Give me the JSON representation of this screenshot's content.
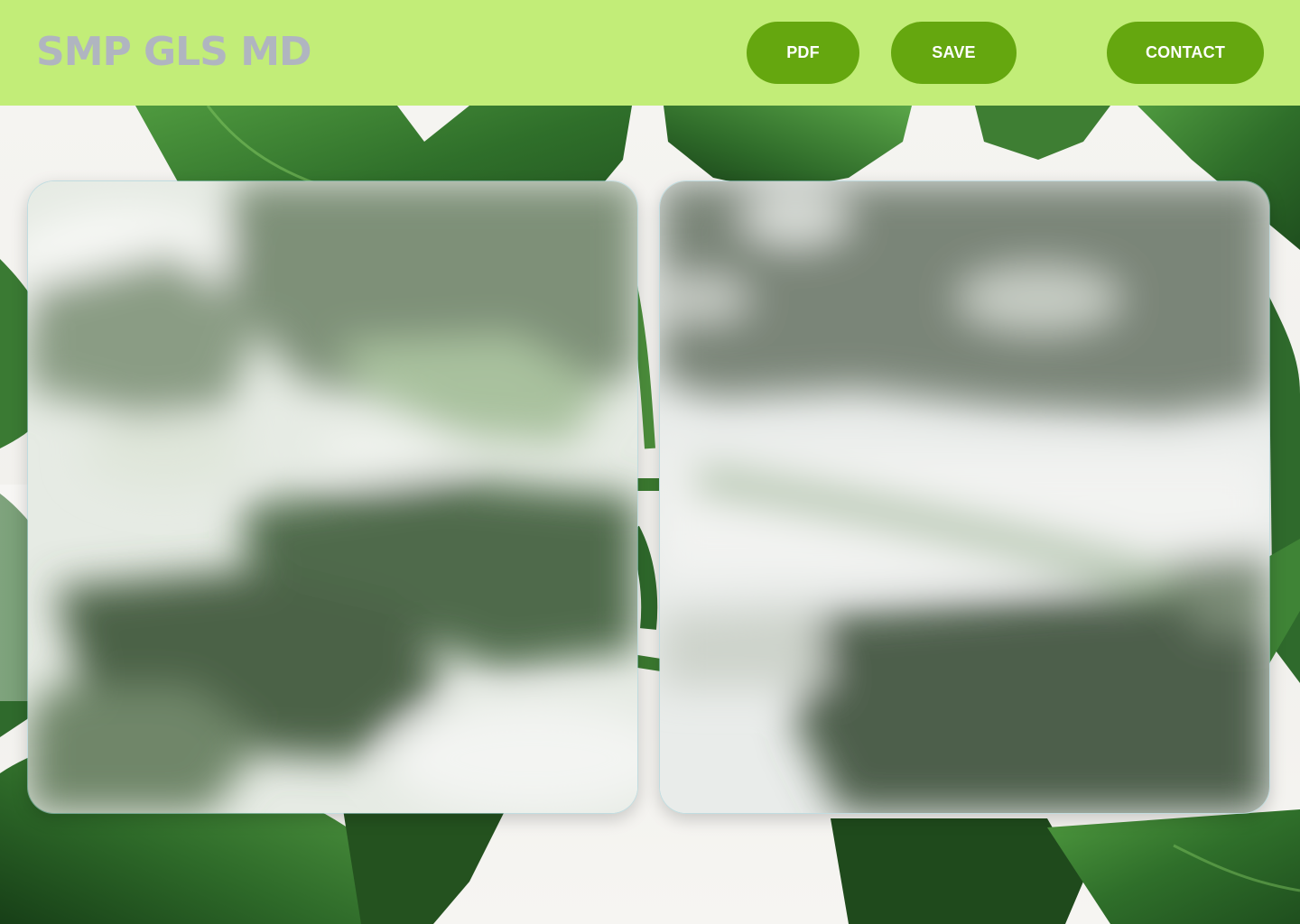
{
  "header": {
    "logo_text": "SMP GLS MD",
    "buttons": {
      "pdf": "PDF",
      "save": "SAVE",
      "contact": "CONTACT"
    }
  },
  "background": {
    "subject": "monstera leaves on white wall",
    "leaf_color": "#2f6a2c"
  },
  "cards": [
    {
      "id": "left",
      "style": "frosted glass"
    },
    {
      "id": "right",
      "style": "frosted glass"
    }
  ],
  "colors": {
    "header_bg": "#c2ed78",
    "button_bg": "#65a70f",
    "button_text": "#ffffff",
    "logo_text": "#b0b5c0"
  }
}
